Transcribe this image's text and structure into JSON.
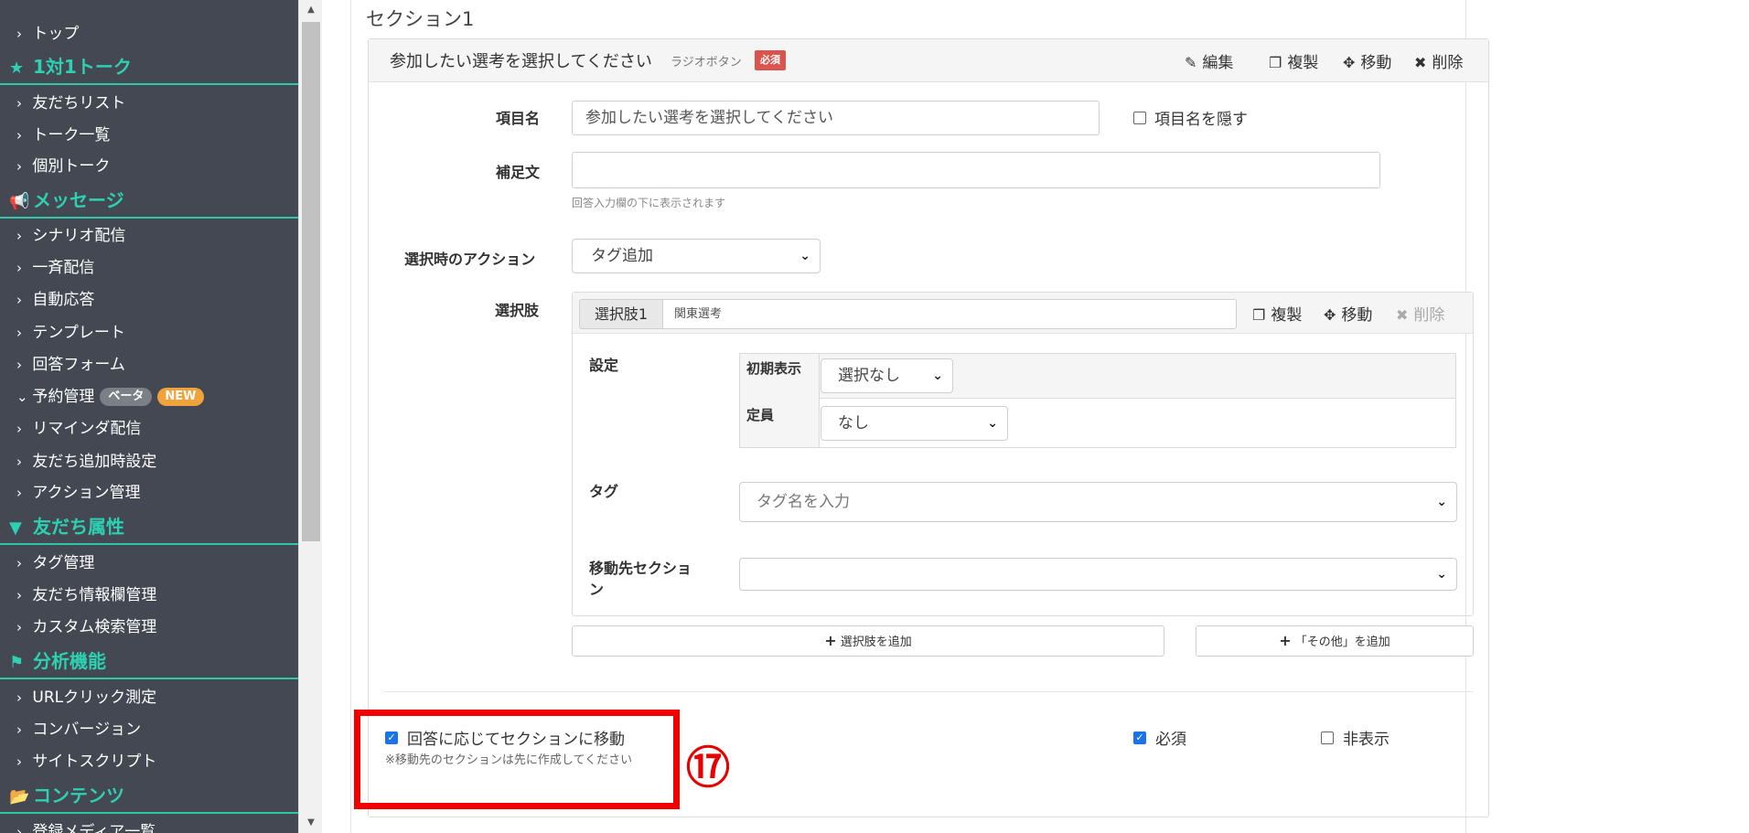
{
  "sidebar": {
    "items": [
      {
        "label": "トップ"
      },
      {
        "label": "1対1トーク"
      },
      {
        "label": "友だちリスト"
      },
      {
        "label": "トーク一覧"
      },
      {
        "label": "個別トーク"
      },
      {
        "label": "メッセージ"
      },
      {
        "label": "シナリオ配信"
      },
      {
        "label": "一斉配信"
      },
      {
        "label": "自動応答"
      },
      {
        "label": "テンプレート"
      },
      {
        "label": "回答フォーム"
      },
      {
        "label": "予約管理"
      },
      {
        "label": "リマインダ配信"
      },
      {
        "label": "友だち追加時設定"
      },
      {
        "label": "アクション管理"
      },
      {
        "label": "友だち属性"
      },
      {
        "label": "タグ管理"
      },
      {
        "label": "友だち情報欄管理"
      },
      {
        "label": "カスタム検索管理"
      },
      {
        "label": "分析機能"
      },
      {
        "label": "URLクリック測定"
      },
      {
        "label": "コンバージョン"
      },
      {
        "label": "サイトスクリプト"
      },
      {
        "label": "コンテンツ"
      },
      {
        "label": "登録メディア一覧"
      }
    ],
    "badges": {
      "beta": "ベータ",
      "new": "NEW"
    }
  },
  "section": {
    "title": "セクション1"
  },
  "question": {
    "title": "参加したい選考を選択してください",
    "type": "ラジオボタン",
    "required_badge": "必須",
    "actions": {
      "edit": "編集",
      "copy": "複製",
      "move": "移動",
      "delete": "削除"
    }
  },
  "form": {
    "item_name_label": "項目名",
    "item_name_value": "参加したい選考を選択してください",
    "hide_name_label": "項目名を隠す",
    "supplement_label": "補足文",
    "supplement_value": "",
    "supplement_help": "回答入力欄の下に表示されます",
    "action_label": "選択時のアクション",
    "action_value": "タグ追加",
    "choices_label": "選択肢"
  },
  "option": {
    "tag": "選択肢1",
    "name": "関東選考",
    "actions": {
      "copy": "複製",
      "move": "移動",
      "delete": "削除"
    },
    "settings_label": "設定",
    "initial_display_label": "初期表示",
    "initial_display_value": "選択なし",
    "capacity_label": "定員",
    "capacity_value": "なし",
    "tag_label": "タグ",
    "tag_placeholder": "タグ名を入力",
    "move_section_label_1": "移動先セクショ",
    "move_section_label_2": "ン",
    "move_section_value": ""
  },
  "buttons": {
    "add_option": "選択肢を追加",
    "add_other": "「その他」を追加"
  },
  "footer": {
    "move_by_answer_label": "回答に応じてセクションに移動",
    "move_by_answer_note": "※移動先のセクションは先に作成してください",
    "required_label": "必須",
    "hidden_label": "非表示"
  },
  "annotation": {
    "number": "⑰",
    "color": "#f20000"
  },
  "colors": {
    "sidebar_bg": "#434853",
    "accent": "#2ed0b2",
    "required_red": "#d9534f",
    "checkbox_blue": "#1a73e8"
  }
}
